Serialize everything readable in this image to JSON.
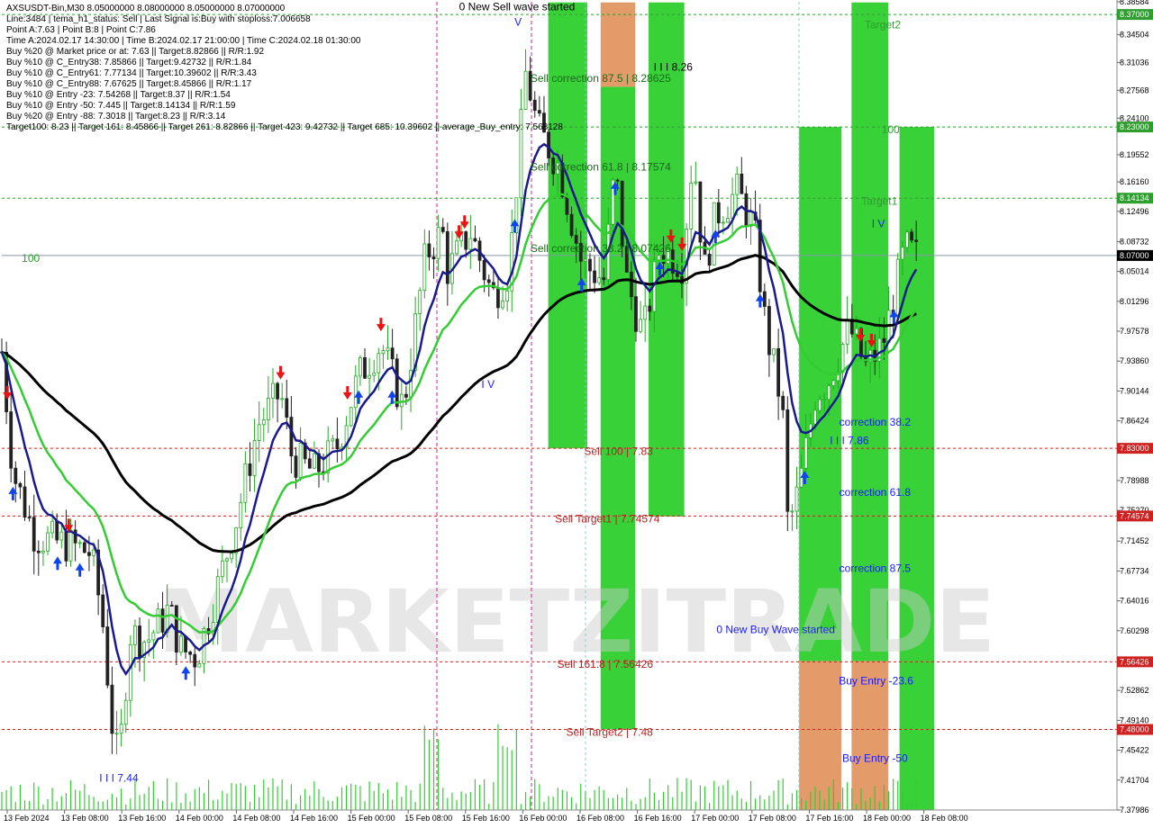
{
  "header": {
    "lines": [
      "AXSUSDT-Bin,M30  8.05000000 8.08000000 8.05000000 8.07000000",
      "Line:3484  | tema_h1_status: Sell  | Last Signal is:Buy with stoploss:7.006658",
      "Point A:7.63  | Point B:8  | Point C:7.86",
      "Time A:2024.02.17 14:30:00  | Time B:2024.02.17 21:00:00  | Time C:2024.02.18 01:30:00",
      "Buy %20 @ Market price or at: 7.63  || Target:8.82866  || R/R:1.92",
      "Buy %10 @ C_Entry38: 7.85866  || Target:9.42732  || R/R:1.84",
      "Buy %10 @ C_Entry61: 7.77134  || Target:10.39602  || R/R:3.43",
      "Buy %10 @ C_Entry88: 7.67625  || Target:8.45866  || R/R:1.17",
      "Buy %10 @ Entry -23: 7.54268  || Target:8.37  || R/R:1.54",
      "Buy %10 @ Entry -50: 7.445  || Target:8.14134  || R/R:1.59",
      "Buy %20 @ Entry -88: 7.3018  || Target:8.23  || R/R:3.14",
      "Target100: 8.23  || Target 161: 8.45866  || Target 261: 8.82866  || Target 423: 9.42732  || Target 685: 10.39602  || average_Buy_entry: 7.568128"
    ]
  },
  "chart_data": {
    "type": "candlestick",
    "symbol": "AXSUSDT-Bin",
    "timeframe": "M30",
    "ylim": [
      7.3798,
      8.3858
    ],
    "price_ticks": [
      "8.38584",
      "8.34504",
      "8.31036",
      "8.27568",
      "8.24100",
      "8.19552",
      "8.16160",
      "8.12496",
      "8.08732",
      "8.05014",
      "8.01296",
      "7.97578",
      "7.93860",
      "7.90144",
      "7.86424",
      "7.82706",
      "7.78988",
      "7.75270",
      "7.71452",
      "7.67734",
      "7.64016",
      "7.60298",
      "7.56580",
      "7.52862",
      "7.49140",
      "7.45422",
      "7.41704",
      "7.37986"
    ],
    "time_labels": [
      "13 Feb 2024",
      "13 Feb 08:00",
      "13 Feb 16:00",
      "14 Feb 00:00",
      "14 Feb 08:00",
      "14 Feb 16:00",
      "15 Feb 00:00",
      "15 Feb 08:00",
      "15 Feb 16:00",
      "16 Feb 00:00",
      "16 Feb 08:00",
      "16 Feb 16:00",
      "17 Feb 00:00",
      "17 Feb 08:00",
      "17 Feb 16:00",
      "18 Feb 00:00",
      "18 Feb 08:00"
    ],
    "last_price": "8.07000",
    "level_tags": [
      {
        "label": "8.37000",
        "value": 8.37,
        "color": "#2e9e2e"
      },
      {
        "label": "8.23000",
        "value": 8.23,
        "color": "#2e9e2e"
      },
      {
        "label": "8.14134",
        "value": 8.14134,
        "color": "#2e9e2e"
      },
      {
        "label": "7.83000",
        "value": 7.83,
        "color": "#cc2222"
      },
      {
        "label": "7.74574",
        "value": 7.74574,
        "color": "#cc2222"
      },
      {
        "label": "7.56426",
        "value": 7.56426,
        "color": "#cc2222"
      },
      {
        "label": "7.48000",
        "value": 7.48,
        "color": "#cc2222"
      }
    ],
    "zones": [
      {
        "t0": 0.49,
        "t1": 0.525,
        "y0": 8.385,
        "y1": 7.83,
        "color": "#22cc22"
      },
      {
        "t0": 0.537,
        "t1": 0.568,
        "y0": 8.385,
        "y1": 8.28,
        "color": "#e0905a"
      },
      {
        "t0": 0.537,
        "t1": 0.568,
        "y0": 8.28,
        "y1": 7.48,
        "color": "#22cc22"
      },
      {
        "t0": 0.58,
        "t1": 0.612,
        "y0": 8.385,
        "y1": 7.745,
        "color": "#22cc22"
      },
      {
        "t0": 0.715,
        "t1": 0.753,
        "y0": 8.23,
        "y1": 7.565,
        "color": "#22cc22"
      },
      {
        "t0": 0.715,
        "t1": 0.753,
        "y0": 7.565,
        "y1": 7.3798,
        "color": "#e0905a"
      },
      {
        "t0": 0.762,
        "t1": 0.795,
        "y0": 8.385,
        "y1": 7.565,
        "color": "#22cc22"
      },
      {
        "t0": 0.762,
        "t1": 0.795,
        "y0": 7.565,
        "y1": 7.3798,
        "color": "#e0905a"
      },
      {
        "t0": 0.805,
        "t1": 0.836,
        "y0": 8.23,
        "y1": 7.3798,
        "color": "#22cc22"
      }
    ],
    "annotations": [
      {
        "text": "0 New Sell wave started",
        "t": 0.462,
        "y": 8.375,
        "color": "#000000"
      },
      {
        "text": "Sell correction 87.5 | 8.28625",
        "t": 0.537,
        "y": 8.28625,
        "color": "#1a6a1a"
      },
      {
        "text": "Sell correction 61.8 | 8.17574",
        "t": 0.537,
        "y": 8.17574,
        "color": "#1a6a1a"
      },
      {
        "text": "Sell correction 38.2 | 8.07426",
        "t": 0.537,
        "y": 8.07426,
        "color": "#1a6a1a"
      },
      {
        "text": "I I I 8.26",
        "t": 0.602,
        "y": 8.3,
        "color": "#000000"
      },
      {
        "text": "Sell 100 | 7.83",
        "t": 0.553,
        "y": 7.822,
        "color": "#b22222"
      },
      {
        "text": "Sell Target1 | 7.74574",
        "t": 0.543,
        "y": 7.738,
        "color": "#b22222"
      },
      {
        "text": "Sell 161.8 | 7.56426",
        "t": 0.541,
        "y": 7.557,
        "color": "#b22222"
      },
      {
        "text": "Sell Target2 | 7.48",
        "t": 0.545,
        "y": 7.472,
        "color": "#b22222"
      },
      {
        "text": "Target2",
        "t": 0.79,
        "y": 8.353,
        "color": "#2e9e2e"
      },
      {
        "text": "100",
        "t": 0.797,
        "y": 8.222,
        "color": "#2e9e2e"
      },
      {
        "text": "Target1",
        "t": 0.787,
        "y": 8.133,
        "color": "#2e9e2e"
      },
      {
        "text": "100",
        "t": 0.026,
        "y": 8.062,
        "color": "#2e9e2e"
      },
      {
        "text": "correction 38.2",
        "t": 0.783,
        "y": 7.858,
        "color": "#1a1aff"
      },
      {
        "text": "I I I 7.86",
        "t": 0.76,
        "y": 7.835,
        "color": "#1a1aff"
      },
      {
        "text": "correction 61.8",
        "t": 0.783,
        "y": 7.771,
        "color": "#1a1aff"
      },
      {
        "text": "correction 87.5",
        "t": 0.783,
        "y": 7.676,
        "color": "#1a1aff"
      },
      {
        "text": "0 New Buy Wave started",
        "t": 0.694,
        "y": 7.6,
        "color": "#1a1aff"
      },
      {
        "text": "Buy Entry -23.6",
        "t": 0.784,
        "y": 7.536,
        "color": "#1a1aff"
      },
      {
        "text": "Buy Entry -50",
        "t": 0.783,
        "y": 7.44,
        "color": "#1a1aff"
      },
      {
        "text": "I I I 7.44",
        "t": 0.105,
        "y": 7.415,
        "color": "#1a1aff"
      },
      {
        "text": "I V",
        "t": 0.436,
        "y": 7.905,
        "color": "#1a1aff"
      },
      {
        "text": "V",
        "t": 0.463,
        "y": 8.356,
        "color": "#1a1aff"
      },
      {
        "text": "I V",
        "t": 0.786,
        "y": 8.105,
        "color": "#1a1aff"
      }
    ],
    "watermark": "MARKETZITRADE",
    "colors": {
      "candle_up": "#22aa22",
      "candle_down": "#222222",
      "ma_fast": "#1a1a8c",
      "ma_mid": "#33cc33",
      "ma_slow": "#000000",
      "zone_green": "#22cc22",
      "zone_orange": "#e0905a",
      "sell_arrow": "#ee1111",
      "buy_arrow": "#1144ee",
      "magenta_line": "#d02090"
    },
    "grid": false
  }
}
